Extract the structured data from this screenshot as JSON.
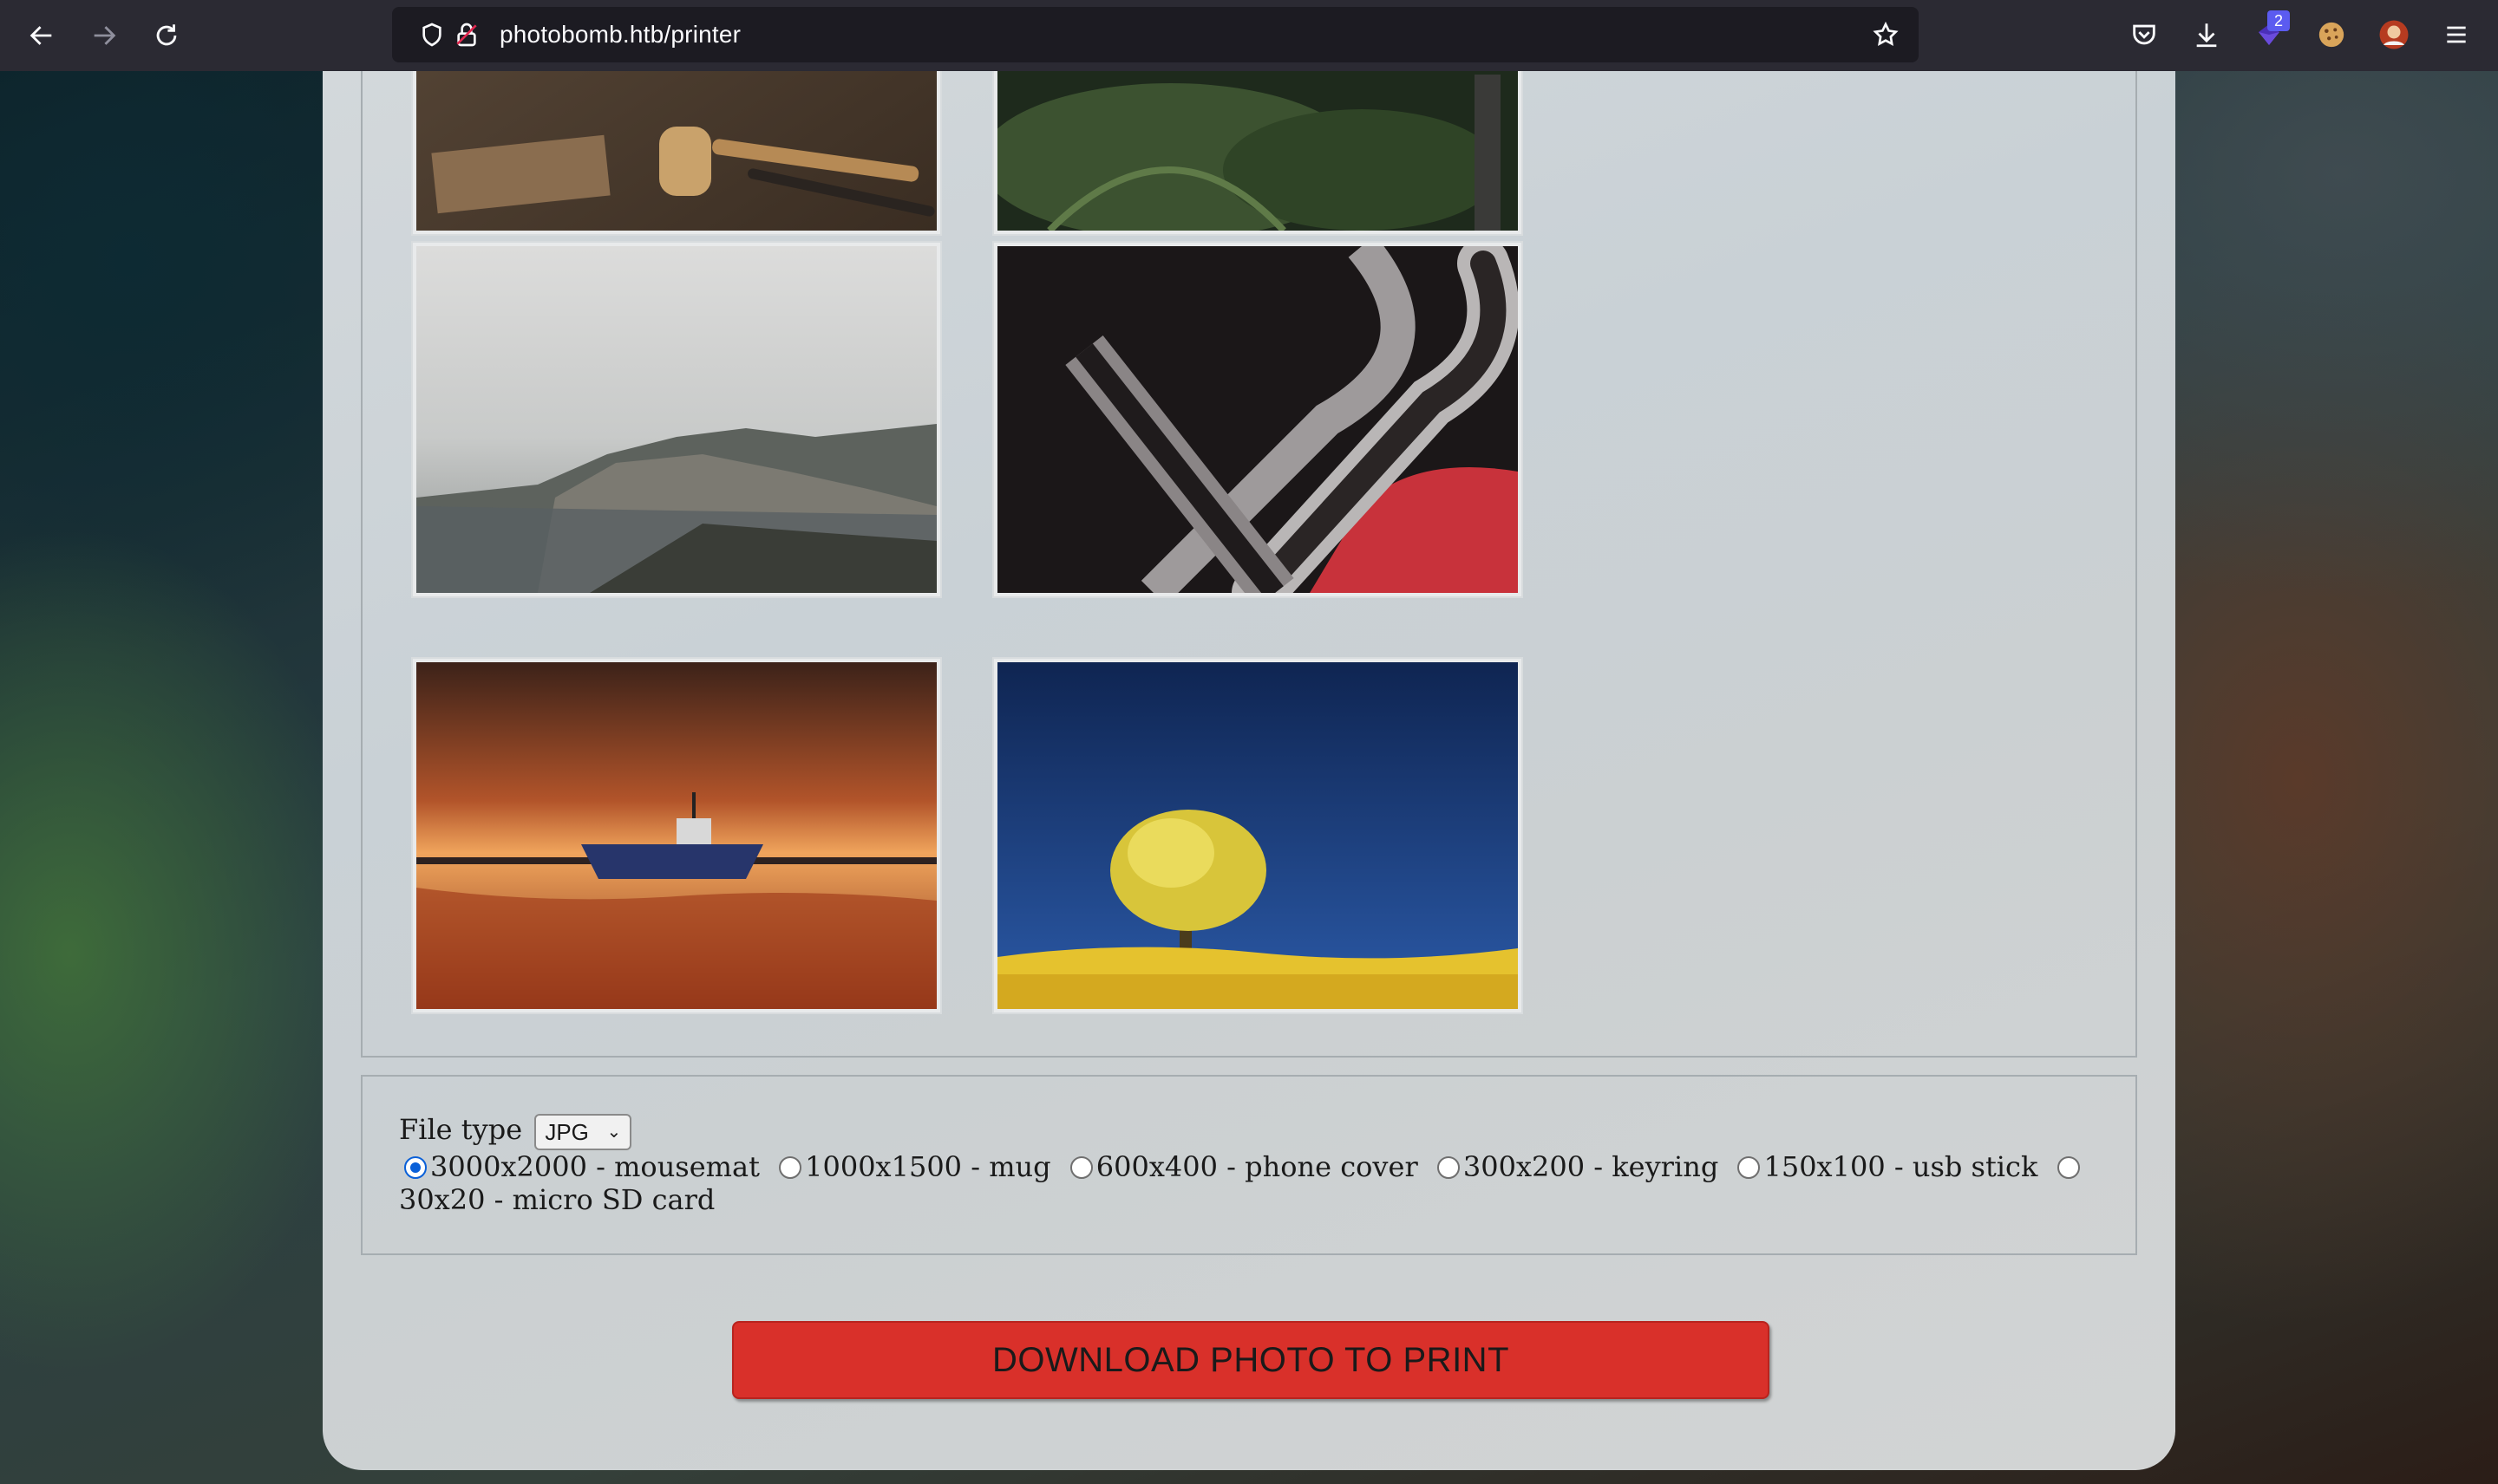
{
  "browser": {
    "url": "photobomb.htb/printer",
    "extension_badge": "2",
    "icons": [
      "back-icon",
      "forward-icon",
      "reload-icon",
      "shield-icon",
      "lock-icon",
      "star-icon",
      "pocket-icon",
      "download-icon",
      "extension-icon",
      "cookie-icon",
      "avatar-icon",
      "menu-icon"
    ]
  },
  "gallery": {
    "images": [
      {
        "name": "wood-tools-photo"
      },
      {
        "name": "ferns-photo"
      },
      {
        "name": "foggy-coast-photo"
      },
      {
        "name": "chrome-curves-photo"
      },
      {
        "name": "boat-sunset-photo"
      },
      {
        "name": "yellow-tree-photo"
      }
    ]
  },
  "options": {
    "file_type_label": "File type",
    "file_type_value": "JPG",
    "sizes": [
      {
        "label": "3000x2000 - mousemat",
        "checked": true
      },
      {
        "label": "1000x1500 - mug",
        "checked": false
      },
      {
        "label": "600x400 - phone cover",
        "checked": false
      },
      {
        "label": "300x200 - keyring",
        "checked": false
      },
      {
        "label": "150x100 - usb stick",
        "checked": false
      },
      {
        "label": "30x20 - micro SD card",
        "checked": false
      }
    ]
  },
  "download_button": "DOWNLOAD PHOTO TO PRINT",
  "colors": {
    "button": "#d9302a",
    "radio_checked": "#0a60d8",
    "toolbar": "#2b2a33"
  }
}
